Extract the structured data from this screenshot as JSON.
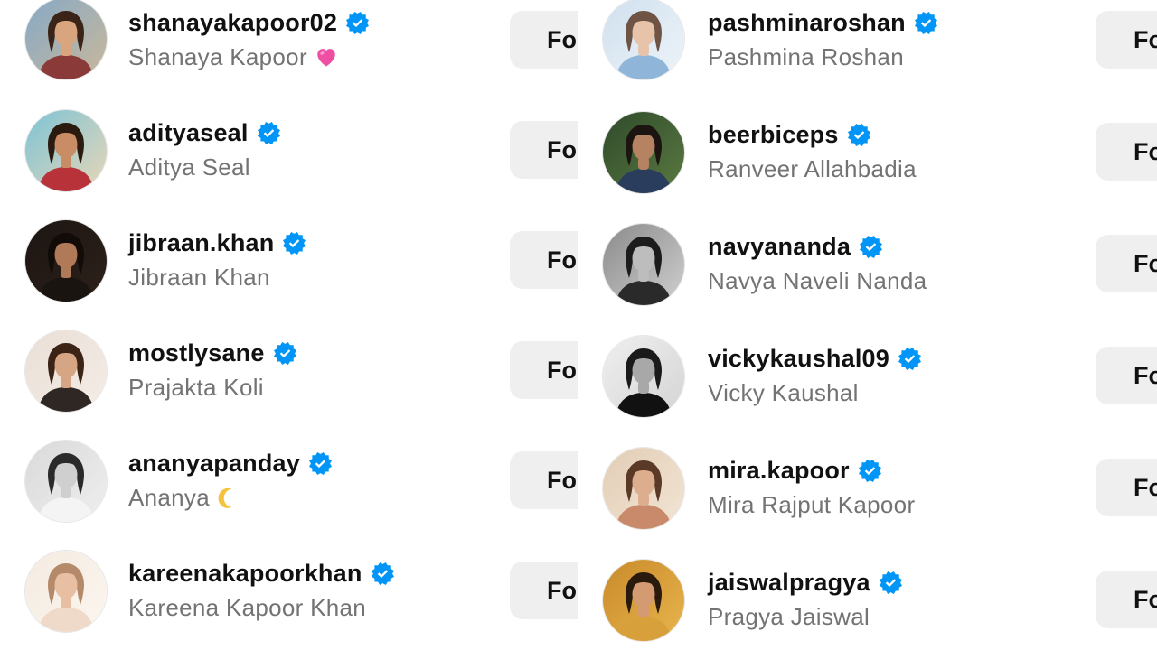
{
  "left_column": [
    {
      "username": "shanayakapoor02",
      "full_name": "Shanaya Kapoor",
      "emoji": "pink-heart",
      "follow_label": "Fo"
    },
    {
      "username": "adityaseal",
      "full_name": "Aditya Seal",
      "emoji": "",
      "follow_label": "Fo"
    },
    {
      "username": "jibraan.khan",
      "full_name": "Jibraan Khan",
      "emoji": "",
      "follow_label": "Fo"
    },
    {
      "username": "mostlysane",
      "full_name": "Prajakta Koli",
      "emoji": "",
      "follow_label": "Fo"
    },
    {
      "username": "ananyapanday",
      "full_name": "Ananya",
      "emoji": "crescent-moon",
      "follow_label": "Fo"
    },
    {
      "username": "kareenakapoorkhan",
      "full_name": "Kareena Kapoor Khan",
      "emoji": "",
      "follow_label": "Fo"
    }
  ],
  "right_column": [
    {
      "username": "pashminaroshan",
      "full_name": "Pashmina Roshan",
      "emoji": "",
      "follow_label": "Fo"
    },
    {
      "username": "beerbiceps",
      "full_name": "Ranveer Allahbadia",
      "emoji": "",
      "follow_label": "Fo"
    },
    {
      "username": "navyananda",
      "full_name": "Navya Naveli Nanda",
      "emoji": "",
      "follow_label": "Fo"
    },
    {
      "username": "vickykaushal09",
      "full_name": "Vicky Kaushal",
      "emoji": "",
      "follow_label": "Fo"
    },
    {
      "username": "mira.kapoor",
      "full_name": "Mira Rajput Kapoor",
      "emoji": "",
      "follow_label": "Fo"
    },
    {
      "username": "jaiswalpragya",
      "full_name": "Pragya Jaiswal",
      "emoji": "",
      "follow_label": "Fo"
    }
  ],
  "colors": {
    "verified_badge": "#0095f6",
    "username_text": "#111111",
    "fullname_text": "#737373",
    "follow_button_bg": "#efefef",
    "emoji_heart": "#ef4fa3",
    "emoji_moon": "#f6c23e"
  },
  "icons": {
    "verified": "verified-badge-icon",
    "pink-heart": "pink-heart-emoji",
    "crescent-moon": "crescent-moon-emoji"
  }
}
